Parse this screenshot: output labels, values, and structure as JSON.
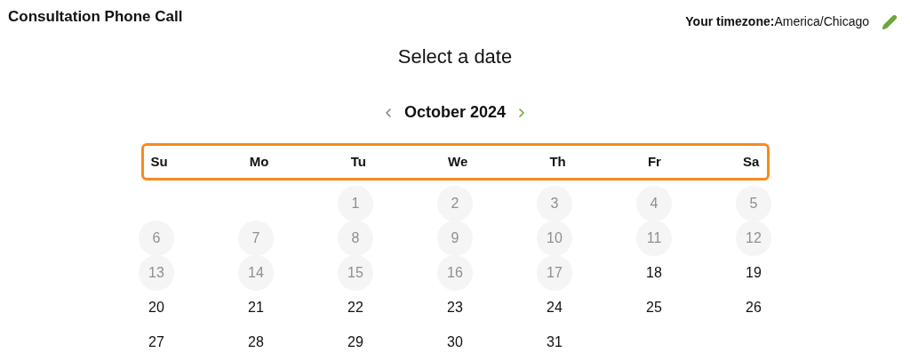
{
  "title": "Consultation Phone Call",
  "timezone": {
    "label": "Your timezone:",
    "value": "America/Chicago"
  },
  "heading": "Select a date",
  "month": {
    "prev": {
      "disabled": true
    },
    "label": "October 2024",
    "next": {
      "disabled": false
    }
  },
  "weekdays": [
    "Su",
    "Mo",
    "Tu",
    "We",
    "Th",
    "Fr",
    "Sa"
  ],
  "weeks": [
    [
      {
        "kind": "blank"
      },
      {
        "kind": "blank"
      },
      {
        "kind": "day",
        "label": "1",
        "disabled": true
      },
      {
        "kind": "day",
        "label": "2",
        "disabled": true
      },
      {
        "kind": "day",
        "label": "3",
        "disabled": true
      },
      {
        "kind": "day",
        "label": "4",
        "disabled": true
      },
      {
        "kind": "day",
        "label": "5",
        "disabled": true
      }
    ],
    [
      {
        "kind": "day",
        "label": "6",
        "disabled": true
      },
      {
        "kind": "day",
        "label": "7",
        "disabled": true
      },
      {
        "kind": "day",
        "label": "8",
        "disabled": true
      },
      {
        "kind": "day",
        "label": "9",
        "disabled": true
      },
      {
        "kind": "day",
        "label": "10",
        "disabled": true
      },
      {
        "kind": "day",
        "label": "11",
        "disabled": true
      },
      {
        "kind": "day",
        "label": "12",
        "disabled": true
      }
    ],
    [
      {
        "kind": "day",
        "label": "13",
        "disabled": true
      },
      {
        "kind": "day",
        "label": "14",
        "disabled": true
      },
      {
        "kind": "day",
        "label": "15",
        "disabled": true
      },
      {
        "kind": "day",
        "label": "16",
        "disabled": true
      },
      {
        "kind": "day",
        "label": "17",
        "disabled": true
      },
      {
        "kind": "day",
        "label": "18",
        "disabled": false
      },
      {
        "kind": "day",
        "label": "19",
        "disabled": false
      }
    ],
    [
      {
        "kind": "day",
        "label": "20",
        "disabled": false
      },
      {
        "kind": "day",
        "label": "21",
        "disabled": false
      },
      {
        "kind": "day",
        "label": "22",
        "disabled": false
      },
      {
        "kind": "day",
        "label": "23",
        "disabled": false
      },
      {
        "kind": "day",
        "label": "24",
        "disabled": false
      },
      {
        "kind": "day",
        "label": "25",
        "disabled": false
      },
      {
        "kind": "day",
        "label": "26",
        "disabled": false
      }
    ],
    [
      {
        "kind": "day",
        "label": "27",
        "disabled": false
      },
      {
        "kind": "day",
        "label": "28",
        "disabled": false
      },
      {
        "kind": "day",
        "label": "29",
        "disabled": false
      },
      {
        "kind": "day",
        "label": "30",
        "disabled": false
      },
      {
        "kind": "day",
        "label": "31",
        "disabled": false
      }
    ]
  ]
}
